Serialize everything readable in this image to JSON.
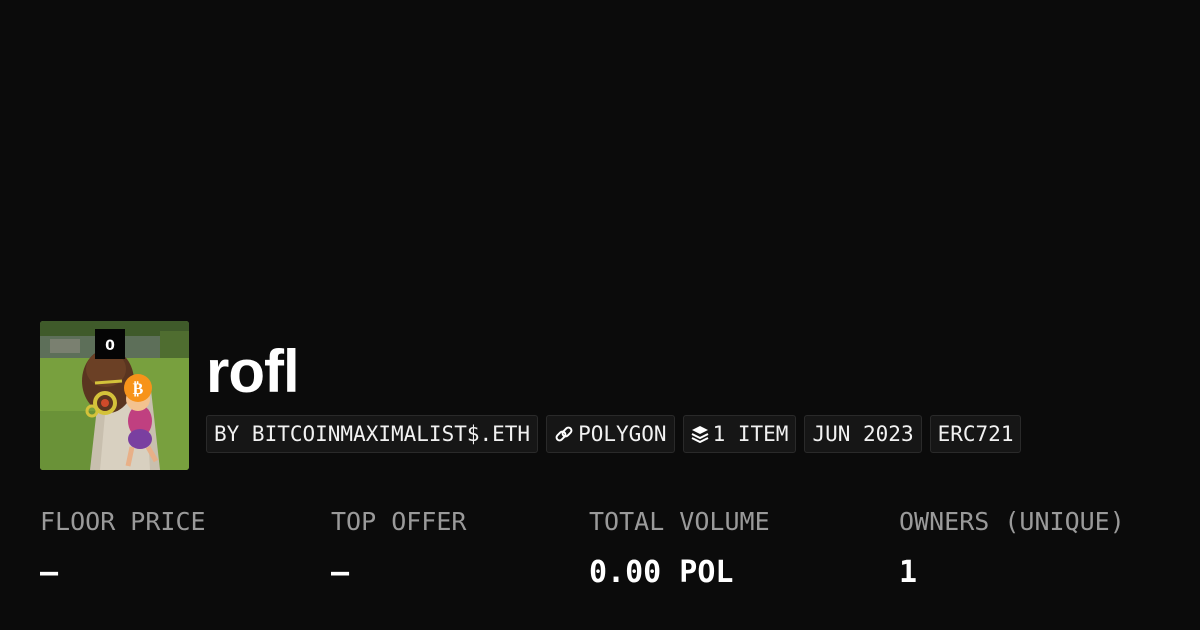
{
  "collection": {
    "name": "rofl",
    "chips": {
      "creator": "BY BITCOINMAXIMALIST$.ETH",
      "chain": "POLYGON",
      "items": "1 ITEM",
      "date": "JUN 2023",
      "standard": "ERC721"
    },
    "icons": {
      "chain": "link-icon",
      "items": "layers-icon",
      "avatar_badge": "bitcoin-icon"
    }
  },
  "stats": [
    {
      "label": "FLOOR PRICE",
      "value": "–"
    },
    {
      "label": "TOP OFFER",
      "value": "–"
    },
    {
      "label": "TOTAL VOLUME",
      "value": "0.00 POL"
    },
    {
      "label": "OWNERS (UNIQUE)",
      "value": "1"
    }
  ],
  "colors": {
    "background": "#0b0b0b",
    "chip_background": "#161616",
    "label": "#9a9a9a",
    "value": "#ffffff",
    "bitcoin_badge": "#f7931a"
  }
}
